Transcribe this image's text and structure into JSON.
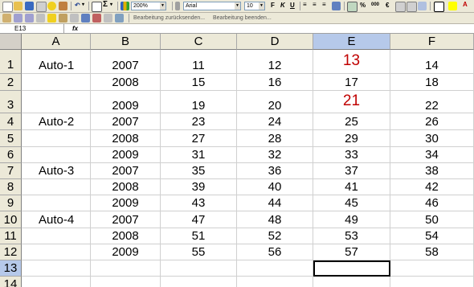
{
  "toolbar": {
    "zoom": "200%",
    "font_name": "Arial",
    "font_size": "10",
    "review_reply_label": "Bearbeitung zurücksenden...",
    "review_end_label": "Bearbeitung beenden...",
    "sum_glyph": "Σ",
    "bold_glyph": "F",
    "italic_glyph": "K",
    "underline_glyph": "U",
    "percent_glyph": "%",
    "thousands_glyph": "000",
    "currency_glyph": "€"
  },
  "formula_bar": {
    "name_box": "E13",
    "fx_label": "fx",
    "content": ""
  },
  "sheet": {
    "columns": [
      "A",
      "B",
      "C",
      "D",
      "E",
      "F"
    ],
    "selected_column": "E",
    "selected_row": 13,
    "rows": [
      {
        "num": "1",
        "cells": [
          "Auto-1",
          "2007",
          "11",
          "12",
          "13",
          "14"
        ],
        "big": [
          4
        ]
      },
      {
        "num": "2",
        "cells": [
          "",
          "2008",
          "15",
          "16",
          "17",
          "18"
        ],
        "big": []
      },
      {
        "num": "3",
        "cells": [
          "",
          "2009",
          "19",
          "20",
          "21",
          "22"
        ],
        "big": [
          4
        ]
      },
      {
        "num": "4",
        "cells": [
          "Auto-2",
          "2007",
          "23",
          "24",
          "25",
          "26"
        ],
        "big": []
      },
      {
        "num": "5",
        "cells": [
          "",
          "2008",
          "27",
          "28",
          "29",
          "30"
        ],
        "big": []
      },
      {
        "num": "6",
        "cells": [
          "",
          "2009",
          "31",
          "32",
          "33",
          "34"
        ],
        "big": []
      },
      {
        "num": "7",
        "cells": [
          "Auto-3",
          "2007",
          "35",
          "36",
          "37",
          "38"
        ],
        "big": []
      },
      {
        "num": "8",
        "cells": [
          "",
          "2008",
          "39",
          "40",
          "41",
          "42"
        ],
        "big": []
      },
      {
        "num": "9",
        "cells": [
          "",
          "2009",
          "43",
          "44",
          "45",
          "46"
        ],
        "big": []
      },
      {
        "num": "10",
        "cells": [
          "Auto-4",
          "2007",
          "47",
          "48",
          "49",
          "50"
        ],
        "big": []
      },
      {
        "num": "11",
        "cells": [
          "",
          "2008",
          "51",
          "52",
          "53",
          "54"
        ],
        "big": []
      },
      {
        "num": "12",
        "cells": [
          "",
          "2009",
          "55",
          "56",
          "57",
          "58"
        ],
        "big": []
      },
      {
        "num": "13",
        "cells": [
          "",
          "",
          "",
          "",
          "",
          ""
        ],
        "big": []
      },
      {
        "num": "14",
        "cells": [
          "",
          "",
          "",
          "",
          "",
          ""
        ],
        "big": []
      }
    ]
  },
  "colors": {
    "highlight_text": "#c00000",
    "selected_header": "#b6c9ea"
  }
}
